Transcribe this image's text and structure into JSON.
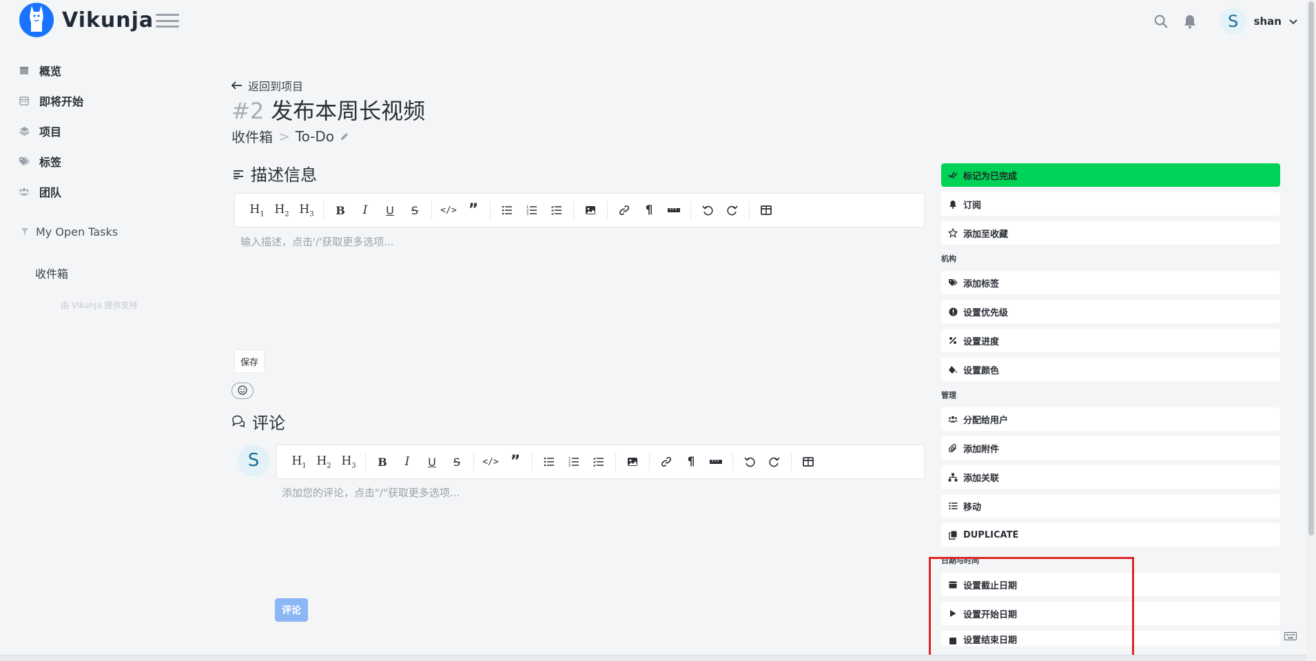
{
  "app": {
    "name": "Vikunja"
  },
  "header": {
    "user": {
      "initial": "S",
      "name": "shan"
    },
    "icons": [
      "search-icon",
      "bell-icon",
      "chevron-down-icon",
      "hamburger-icon"
    ]
  },
  "sidebar": {
    "items": [
      {
        "label": "概览",
        "icon": "calendar-icon"
      },
      {
        "label": "即将开始",
        "icon": "calendar-grid-icon"
      },
      {
        "label": "项目",
        "icon": "layers-icon"
      },
      {
        "label": "标签",
        "icon": "tags-icon"
      },
      {
        "label": "团队",
        "icon": "users-icon"
      }
    ],
    "saved_filter": "My Open Tasks",
    "project": "收件箱",
    "powered_by": "由 Vikunja 提供支持"
  },
  "task": {
    "back_label": "返回到项目",
    "index": "#2",
    "title": "发布本周长视频",
    "breadcrumb": [
      "收件箱",
      "To-Do"
    ]
  },
  "description": {
    "heading": "描述信息",
    "placeholder": "输入描述，点击'/'获取更多选项...",
    "save_label": "保存"
  },
  "comments": {
    "heading": "评论",
    "avatar_initial": "S",
    "placeholder": "添加您的评论，点击\"/\"获取更多选项...",
    "submit_label": "评论"
  },
  "actions": {
    "top": [
      {
        "label": "标记为已完成",
        "icon": "check-double-icon"
      },
      {
        "label": "订阅",
        "icon": "bell-icon"
      },
      {
        "label": "添加至收藏",
        "icon": "star-icon"
      }
    ],
    "groups": [
      {
        "heading": "机构",
        "items": [
          {
            "label": "添加标签",
            "icon": "tags-icon"
          },
          {
            "label": "设置优先级",
            "icon": "exclamation-circle-icon"
          },
          {
            "label": "设置进度",
            "icon": "percent-icon"
          },
          {
            "label": "设置颜色",
            "icon": "paint-bucket-icon"
          }
        ]
      },
      {
        "heading": "管理",
        "items": [
          {
            "label": "分配给用户",
            "icon": "users-icon"
          },
          {
            "label": "添加附件",
            "icon": "paperclip-icon"
          },
          {
            "label": "添加关联",
            "icon": "sitemap-icon"
          },
          {
            "label": "移动",
            "icon": "list-icon"
          },
          {
            "label": "DUPLICATE",
            "icon": "copy-icon"
          }
        ]
      },
      {
        "heading": "日期与时间",
        "items": [
          {
            "label": "设置截止日期",
            "icon": "calendar-icon"
          },
          {
            "label": "设置开始日期",
            "icon": "play-icon"
          },
          {
            "label": "设置结束日期",
            "icon": "stop-icon"
          }
        ]
      }
    ]
  },
  "colors": {
    "accent": "#1973ff",
    "done": "#00d257",
    "comment_button": "#8cb7f5",
    "highlight": "#e02424"
  }
}
